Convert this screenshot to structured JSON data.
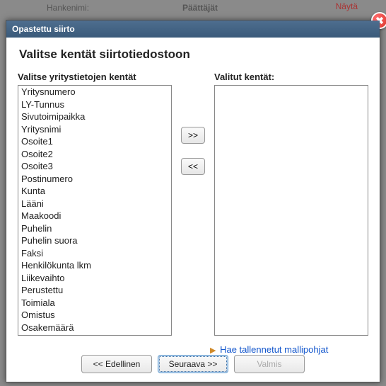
{
  "background": {
    "label1": "Hankenimi:",
    "label2": "Päättäjät",
    "icon_text": "Näytä",
    "right_text": "ätä"
  },
  "modal": {
    "header_title": "Opastettu siirto",
    "page_title": "Valitse kentät siirtotiedostoon",
    "left_label": "Valitse yritystietojen kentät",
    "right_label": "Valitut kentät:",
    "move_right": ">>",
    "move_left": "<<",
    "available_fields": [
      "Yritysnumero",
      "LY-Tunnus",
      "Sivutoimipaikka",
      "Yritysnimi",
      "Osoite1",
      "Osoite2",
      "Osoite3",
      "Postinumero",
      "Kunta",
      "Lääni",
      "Maakoodi",
      "Puhelin",
      "Puhelin suora",
      "Faksi",
      "Henkilökunta lkm",
      "Liikevaihto",
      "Perustettu",
      "Toimiala",
      "Omistus",
      "Osakemäärä"
    ],
    "selected_fields": [],
    "templates_link": "Hae tallennetut mallipohjat",
    "footer": {
      "prev": "<< Edellinen",
      "next": "Seuraava >>",
      "finish": "Valmis"
    }
  }
}
